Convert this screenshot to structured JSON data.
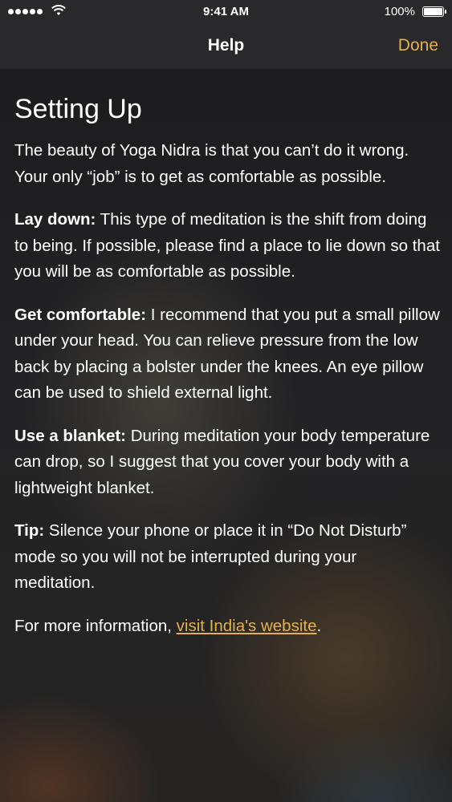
{
  "status_bar": {
    "time": "9:41 AM",
    "battery": "100%"
  },
  "nav": {
    "title": "Help",
    "done_label": "Done"
  },
  "content": {
    "heading": "Setting Up",
    "intro": "The beauty of Yoga Nidra is that you can’t do it wrong. Your only “job” is to get as comfortable as possible.",
    "sections": [
      {
        "label": "Lay down:",
        "text": " This type of meditation is the shift from doing to being. If possible, please find a place to lie down so that you will be as comfortable as possible."
      },
      {
        "label": "Get comfortable:",
        "text": " I recommend that you put a small pillow under your head. You can relieve pressure from the low back by placing a bolster under the knees. An eye pillow can be used to shield external light."
      },
      {
        "label": "Use a blanket:",
        "text": " During meditation your body temperature can drop, so I suggest that you cover your body with a lightweight blanket."
      },
      {
        "label": "Tip:",
        "text": " Silence your phone or place it in “Do Not Disturb” mode so you will not be interrupted during your meditation."
      }
    ],
    "more_info_prefix": "For more information, ",
    "more_info_link": "visit India's website",
    "more_info_suffix": "."
  },
  "colors": {
    "accent": "#e3b04b",
    "bar_bg": "#29292b"
  },
  "icons": [
    "signal-dots-icon",
    "wifi-icon",
    "battery-icon"
  ]
}
